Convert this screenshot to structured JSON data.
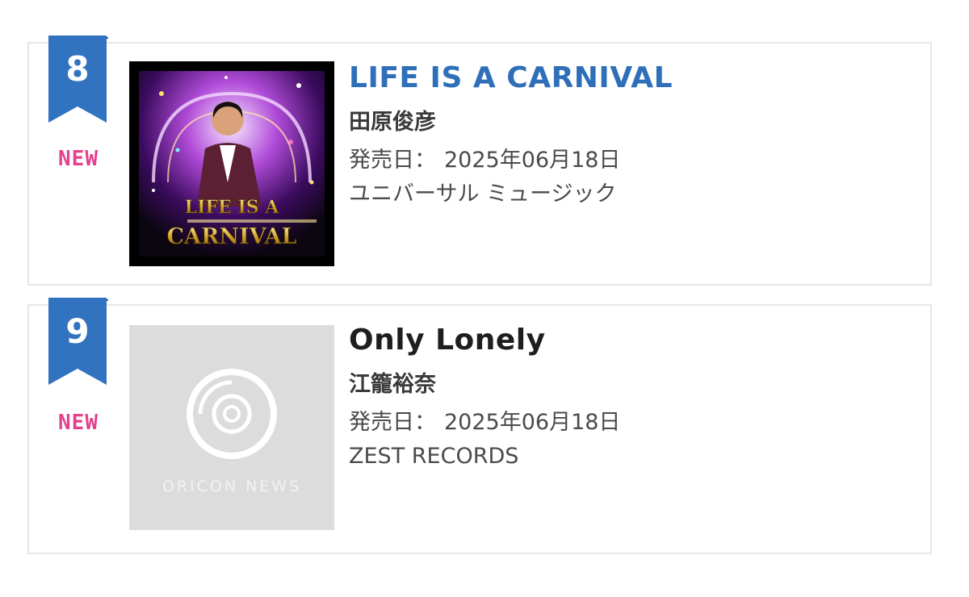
{
  "brand": {
    "rank_color": "#3273c0",
    "new_color": "#e4418c",
    "link_color": "#2f6fb9"
  },
  "entries": [
    {
      "rank": "8",
      "badge": "NEW",
      "title": "LIFE IS A CARNIVAL",
      "artist": "田原俊彦",
      "release_label": "発売日：",
      "release_date": "2025年06月18日",
      "record_label": "ユニバーサル ミュージック",
      "cover": {
        "type": "artwork",
        "text_top": "LIFE IS A",
        "text_bottom": "CARNIVAL"
      }
    },
    {
      "rank": "9",
      "badge": "NEW",
      "title": "Only Lonely",
      "artist": "江籠裕奈",
      "release_label": "発売日：",
      "release_date": "2025年06月18日",
      "record_label": "ZEST RECORDS",
      "cover": {
        "type": "placeholder",
        "text": "ORICON NEWS",
        "icon": "disc-icon"
      }
    }
  ]
}
